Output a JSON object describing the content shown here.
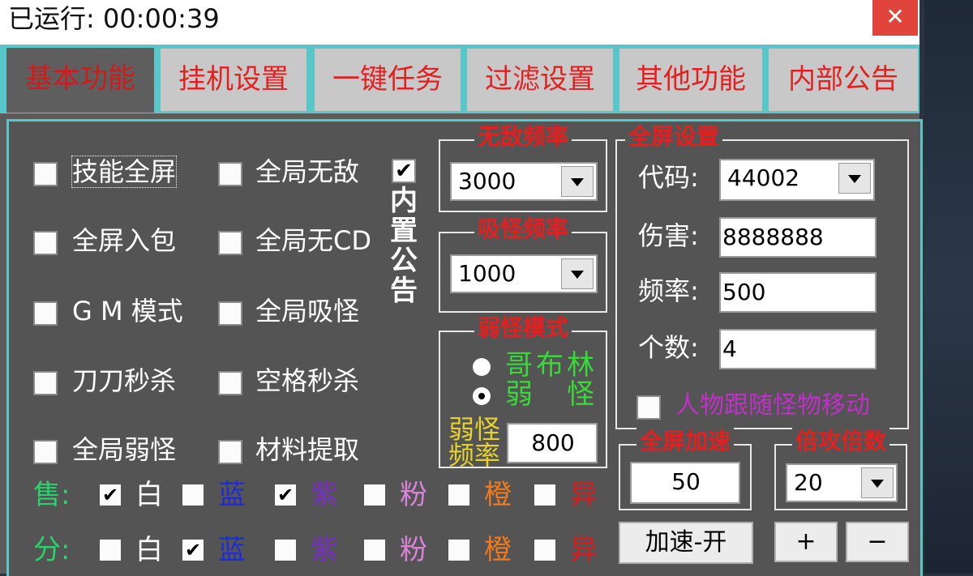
{
  "window": {
    "title": "已运行: 00:00:39",
    "close_glyph": "✕"
  },
  "tabs": [
    {
      "label": "基本功能",
      "active": true
    },
    {
      "label": "挂机设置",
      "active": false
    },
    {
      "label": "一键任务",
      "active": false
    },
    {
      "label": "过滤设置",
      "active": false
    },
    {
      "label": "其他功能",
      "active": false
    },
    {
      "label": "内部公告",
      "active": false
    }
  ],
  "checks": {
    "skill_fullscreen": {
      "label": "技能全屏",
      "checked": false
    },
    "global_invincible": {
      "label": "全局无敌",
      "checked": false
    },
    "fullscreen_pickup": {
      "label": "全屏入包",
      "checked": false
    },
    "global_no_cd": {
      "label": "全局无CD",
      "checked": false
    },
    "gm_mode": {
      "label": "G M 模式",
      "checked": false
    },
    "global_lure": {
      "label": "全局吸怪",
      "checked": false
    },
    "one_hit_kill": {
      "label": "刀刀秒杀",
      "checked": false
    },
    "space_kill": {
      "label": "空格秒杀",
      "checked": false
    },
    "global_weak": {
      "label": "全局弱怪",
      "checked": false
    },
    "material_extract": {
      "label": "材料提取",
      "checked": false
    },
    "builtin_notice": {
      "label": "内置公告",
      "checked": true,
      "check_glyph": "✔"
    },
    "follow_monster": {
      "label": "人物跟随怪物移动",
      "checked": false
    }
  },
  "invincible_freq": {
    "title": "无敌频率",
    "value": "3000"
  },
  "lure_freq": {
    "title": "吸怪频率",
    "value": "1000"
  },
  "weak_mode": {
    "title": "弱怪模式",
    "options": [
      {
        "label": "哥布林",
        "selected": false
      },
      {
        "label": "弱　怪",
        "selected": true
      }
    ],
    "freq_label_1": "弱怪",
    "freq_label_2": "频率",
    "freq_value": "800"
  },
  "fullscreen_settings": {
    "title": "全屏设置",
    "code_label": "代码:",
    "code_value": "44002",
    "damage_label": "伤害:",
    "damage_value": "8888888",
    "freq_label": "频率:",
    "freq_value": "500",
    "count_label": "个数:",
    "count_value": "4"
  },
  "speedup": {
    "title": "全屏加速",
    "value": "50",
    "button": "加速-开"
  },
  "multiplier": {
    "title": "倍攻倍数",
    "value": "20",
    "plus": "+",
    "minus": "−"
  },
  "sell": {
    "label": "售:",
    "items": [
      {
        "name": "白",
        "checked": true,
        "color": "#ffffff"
      },
      {
        "name": "蓝",
        "checked": false,
        "color": "#1f2bd6"
      },
      {
        "name": "紫",
        "checked": true,
        "color": "#7a2fc4"
      },
      {
        "name": "粉",
        "checked": false,
        "color": "#d882d8"
      },
      {
        "name": "橙",
        "checked": false,
        "color": "#f07a1c"
      },
      {
        "name": "异",
        "checked": false,
        "color": "#d41c1c"
      }
    ]
  },
  "split": {
    "label": "分:",
    "items": [
      {
        "name": "白",
        "checked": false,
        "color": "#ffffff"
      },
      {
        "name": "蓝",
        "checked": true,
        "color": "#1f2bd6"
      },
      {
        "name": "紫",
        "checked": false,
        "color": "#7a2fc4"
      },
      {
        "name": "粉",
        "checked": false,
        "color": "#d882d8"
      },
      {
        "name": "橙",
        "checked": false,
        "color": "#f07a1c"
      },
      {
        "name": "异",
        "checked": false,
        "color": "#d41c1c"
      }
    ]
  },
  "colors": {
    "accent_cyan": "#59c7c9",
    "tab_text_red": "#e41f1f",
    "sell_green": "#2bd16a",
    "weak_green": "#3bd83b",
    "freq_yellow": "#e6d22e",
    "follow_magenta": "#c22fc9"
  }
}
